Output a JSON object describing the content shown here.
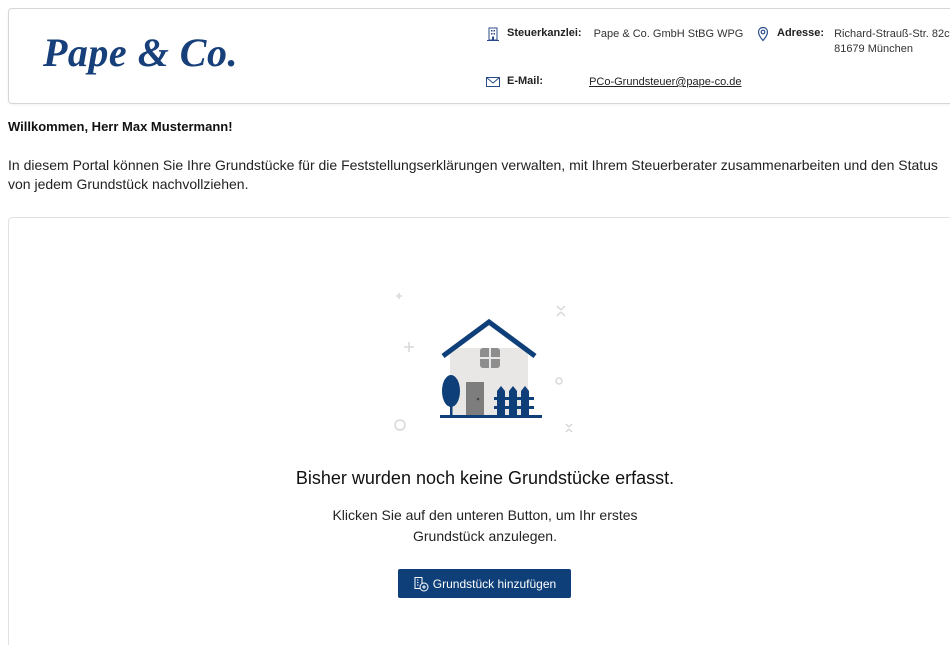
{
  "header": {
    "logo_text": "Pape & Co.",
    "firm": {
      "label": "Steuerkanzlei:",
      "value": "Pape & Co. GmbH StBG WPG"
    },
    "address": {
      "label": "Adresse:",
      "line1": "Richard-Strauß-Str. 82c",
      "line2": "81679 München"
    },
    "email": {
      "label": "E-Mail:",
      "value": "PCo-Grundsteuer@pape-co.de"
    }
  },
  "welcome": "Willkommen, Herr Max Mustermann!",
  "intro": "In diesem Portal können Sie Ihre Grundstücke für die Feststellungserklärungen verwalten, mit Ihrem Steuerberater zusammenarbeiten und den Status von jedem Grundstück nachvollziehen.",
  "empty_state": {
    "title": "Bisher wurden noch keine Grundstücke erfasst.",
    "text": "Klicken Sie auf den unteren Button, um Ihr erstes Grundstück anzulegen.",
    "button_label": "Grundstück hinzufügen"
  },
  "colors": {
    "brand": "#173f7a",
    "button": "#0e3f78",
    "illustration_blue": "#0e3f78"
  },
  "icons": [
    "building-icon",
    "location-pin-icon",
    "envelope-icon",
    "add-property-icon",
    "house-illustration"
  ]
}
